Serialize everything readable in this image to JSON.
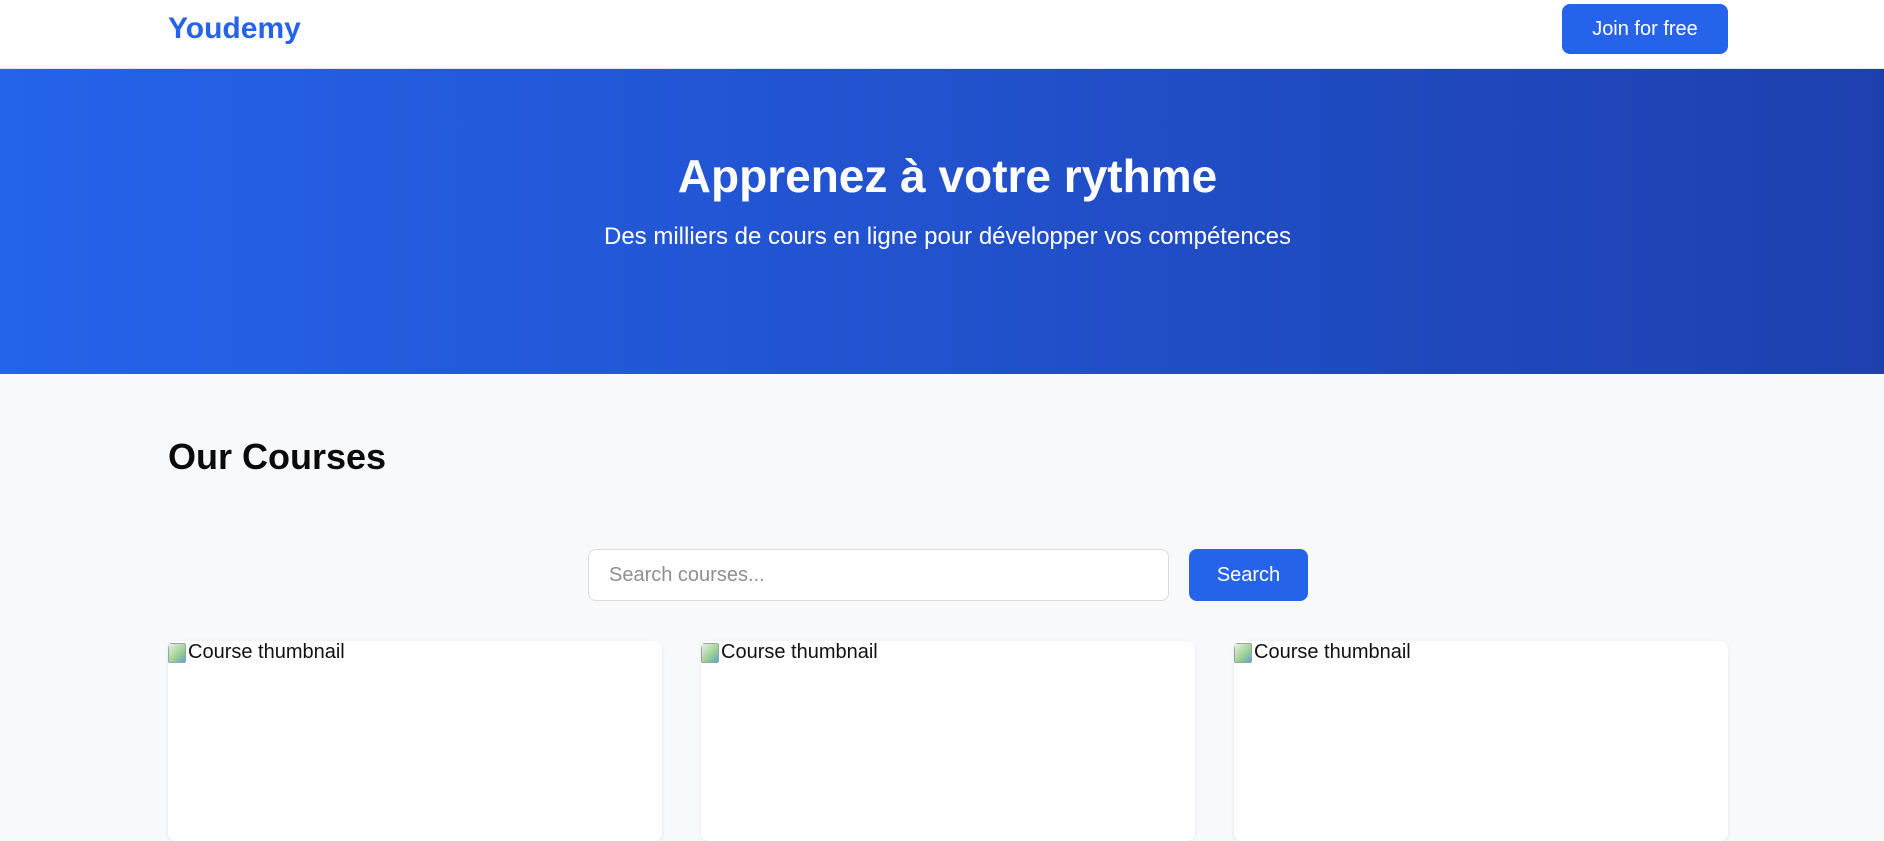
{
  "header": {
    "logo": "Youdemy",
    "join_label": "Join for free"
  },
  "hero": {
    "title": "Apprenez à votre rythme",
    "subtitle": "Des milliers de cours en ligne pour développer vos compétences"
  },
  "courses": {
    "title": "Our Courses",
    "search": {
      "placeholder": "Search courses...",
      "value": "",
      "button_label": "Search"
    },
    "cards": [
      {
        "thumbnail_alt": "Course thumbnail"
      },
      {
        "thumbnail_alt": "Course thumbnail"
      },
      {
        "thumbnail_alt": "Course thumbnail"
      }
    ]
  },
  "colors": {
    "brand": "#2563eb",
    "hero_gradient_end": "#1e40af",
    "page_background": "#f8f9fb"
  },
  "icons": {
    "broken_image": "broken-image-icon"
  }
}
